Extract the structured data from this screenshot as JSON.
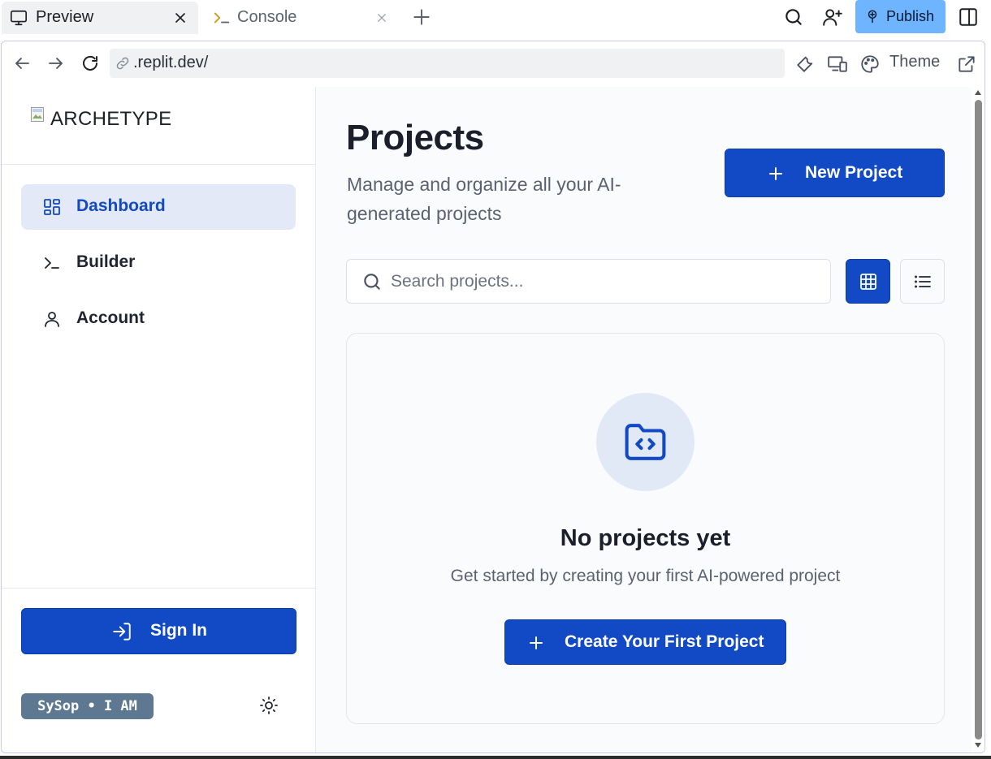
{
  "workspace": {
    "tabs": [
      {
        "label": "Preview",
        "icon": "monitor-icon",
        "active": true
      },
      {
        "label": "Console",
        "icon": "terminal-icon",
        "active": false
      }
    ],
    "publish_label": "Publish",
    "accent_color": "#6fb4ff"
  },
  "browser": {
    "url": ".replit.dev/",
    "theme_label": "Theme"
  },
  "sidebar": {
    "logo_alt": "ARCHETYPE",
    "items": [
      {
        "label": "Dashboard",
        "icon": "dashboard-icon",
        "active": true
      },
      {
        "label": "Builder",
        "icon": "terminal-icon",
        "active": false
      },
      {
        "label": "Account",
        "icon": "user-icon",
        "active": false
      }
    ],
    "signin_label": "Sign In",
    "badge": "SySop • I AM"
  },
  "main": {
    "title": "Projects",
    "subtitle": "Manage and organize all your AI-generated projects",
    "new_project_label": "New Project",
    "search_placeholder": "Search projects...",
    "view_mode": "grid",
    "empty": {
      "title": "No projects yet",
      "subtitle": "Get started by creating your first AI-powered project",
      "cta_label": "Create Your First Project"
    }
  },
  "colors": {
    "primary": "#114ac4",
    "active_nav_bg": "#e3e9f6",
    "badge_bg": "#5f7891"
  }
}
